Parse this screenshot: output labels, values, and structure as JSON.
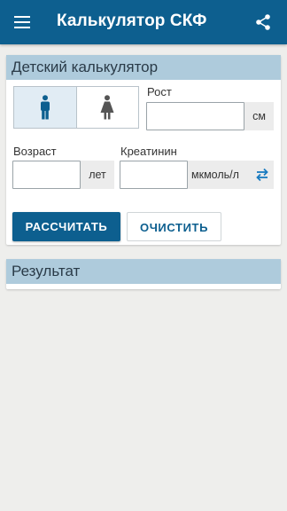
{
  "appbar": {
    "title": "Калькулятор СКФ",
    "menu_icon": "hamburger-menu-icon",
    "share_icon": "share-icon",
    "color": "#0d5f8f"
  },
  "calculator": {
    "heading": "Детский калькулятор",
    "gender": {
      "options": [
        "male-icon",
        "female-icon"
      ],
      "selected": "male-icon"
    },
    "height": {
      "label": "Рост",
      "value": "",
      "unit": "см"
    },
    "age": {
      "label": "Возраст",
      "value": "",
      "unit": "лет"
    },
    "creatinine": {
      "label": "Креатинин",
      "value": "",
      "unit": "мкмоль/л",
      "swap_icon": "swap-units-icon"
    },
    "buttons": {
      "calculate": "РАССЧИТАТЬ",
      "clear": "ОЧИСТИТЬ"
    }
  },
  "result": {
    "heading": "Результат"
  }
}
